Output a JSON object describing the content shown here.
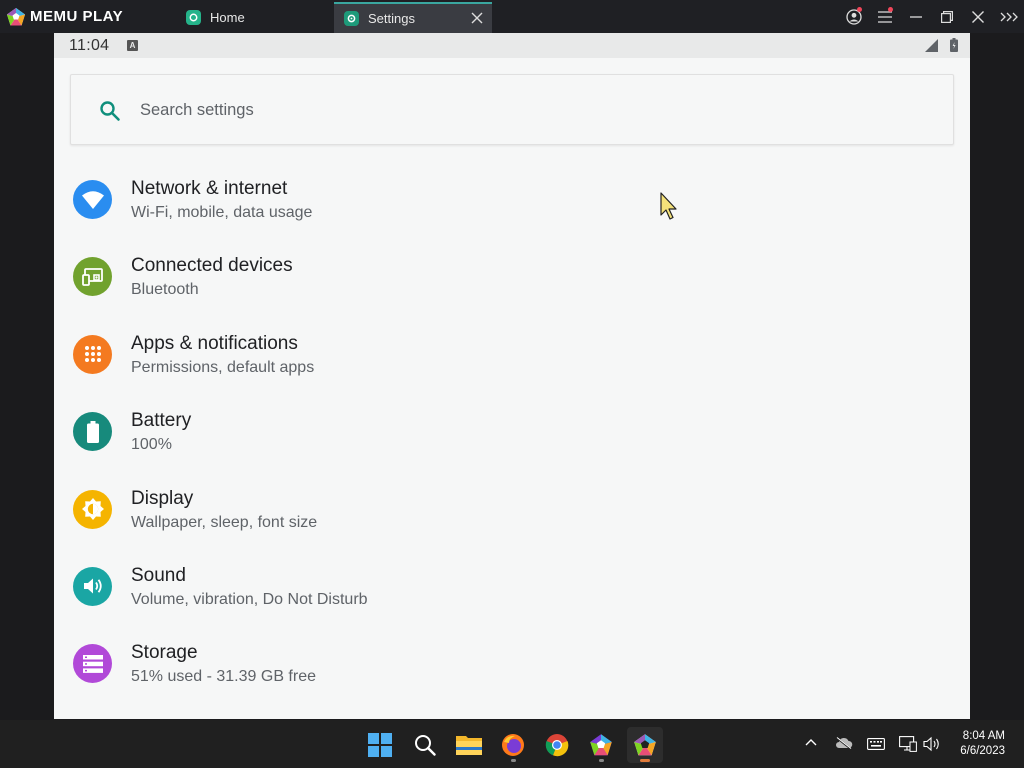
{
  "app": {
    "brand": "MEMU PLAY",
    "tabs": [
      {
        "label": "Home",
        "active": false
      },
      {
        "label": "Settings",
        "active": true
      }
    ]
  },
  "statusbar": {
    "time": "11:04",
    "notification_badge": "A"
  },
  "search": {
    "placeholder": "Search settings",
    "value": ""
  },
  "settings": [
    {
      "title": "Network & internet",
      "subtitle": "Wi-Fi, mobile, data usage",
      "icon": "wifi-icon",
      "color": "#2a8df0"
    },
    {
      "title": "Connected devices",
      "subtitle": "Bluetooth",
      "icon": "devices-icon",
      "color": "#71a22e"
    },
    {
      "title": "Apps & notifications",
      "subtitle": "Permissions, default apps",
      "icon": "apps-grid-icon",
      "color": "#f47a20"
    },
    {
      "title": "Battery",
      "subtitle": "100%",
      "icon": "battery-icon",
      "color": "#178a7c"
    },
    {
      "title": "Display",
      "subtitle": "Wallpaper, sleep, font size",
      "icon": "brightness-icon",
      "color": "#f5b400"
    },
    {
      "title": "Sound",
      "subtitle": "Volume, vibration, Do Not Disturb",
      "icon": "volume-icon",
      "color": "#1aa6a4"
    },
    {
      "title": "Storage",
      "subtitle": "51% used - 31.39 GB free",
      "icon": "storage-icon",
      "color": "#b149d8"
    }
  ],
  "taskbar": {
    "apps": [
      "windows-start-icon",
      "search-icon",
      "file-explorer-icon",
      "firefox-icon",
      "chrome-icon",
      "memu-multi-icon",
      "memu-icon"
    ],
    "time": "8:04 AM",
    "date": "6/6/2023"
  }
}
